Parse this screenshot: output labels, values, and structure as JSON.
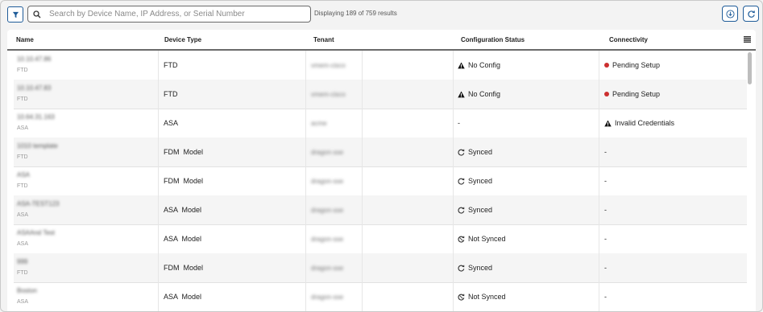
{
  "toolbar": {
    "search_placeholder": "Search by Device Name, IP Address, or Serial Number",
    "results_text": "Displaying 189 of 759 results",
    "accent_color": "#1f5c99"
  },
  "table": {
    "columns": [
      "Name",
      "Device Type",
      "Tenant",
      "Configuration Status",
      "Connectivity"
    ],
    "rows": [
      {
        "name": "10.10.47.86",
        "sub": "FTD",
        "device_type": "FTD",
        "tenant": "vmem-cisco",
        "config": "No Config",
        "config_icon": "warning-icon",
        "connectivity": "Pending Setup",
        "conn_icon": "red-dot-icon"
      },
      {
        "name": "10.10.47.83",
        "sub": "FTD",
        "device_type": "FTD",
        "tenant": "vmem-cisco",
        "config": "No Config",
        "config_icon": "warning-icon",
        "connectivity": "Pending Setup",
        "conn_icon": "red-dot-icon"
      },
      {
        "name": "10.64.31.163",
        "sub": "ASA",
        "device_type": "ASA",
        "tenant": "acme",
        "config": "-",
        "config_icon": "",
        "connectivity": "Invalid Credentials",
        "conn_icon": "warning-icon"
      },
      {
        "name": "1010 template",
        "sub": "FTD",
        "device_type": "FDM  Model",
        "tenant": "dragon-sse",
        "config": "Synced",
        "config_icon": "synced-icon",
        "connectivity": "-",
        "conn_icon": ""
      },
      {
        "name": "ASA",
        "sub": "FTD",
        "device_type": "FDM  Model",
        "tenant": "dragon-sse",
        "config": "Synced",
        "config_icon": "synced-icon",
        "connectivity": "-",
        "conn_icon": ""
      },
      {
        "name": "ASA-TEST123",
        "sub": "ASA",
        "device_type": "ASA  Model",
        "tenant": "dragon-sse",
        "config": "Synced",
        "config_icon": "synced-icon",
        "connectivity": "-",
        "conn_icon": ""
      },
      {
        "name": "ASAAnd Test",
        "sub": "ASA",
        "device_type": "ASA  Model",
        "tenant": "dragon-sse",
        "config": "Not Synced",
        "config_icon": "not-synced-icon",
        "connectivity": "-",
        "conn_icon": ""
      },
      {
        "name": "999",
        "sub": "FTD",
        "device_type": "FDM  Model",
        "tenant": "dragon-sse",
        "config": "Synced",
        "config_icon": "synced-icon",
        "connectivity": "-",
        "conn_icon": ""
      },
      {
        "name": "Boston",
        "sub": "ASA",
        "device_type": "ASA  Model",
        "tenant": "dragon-sse",
        "config": "Not Synced",
        "config_icon": "not-synced-icon",
        "connectivity": "-",
        "conn_icon": ""
      }
    ]
  }
}
